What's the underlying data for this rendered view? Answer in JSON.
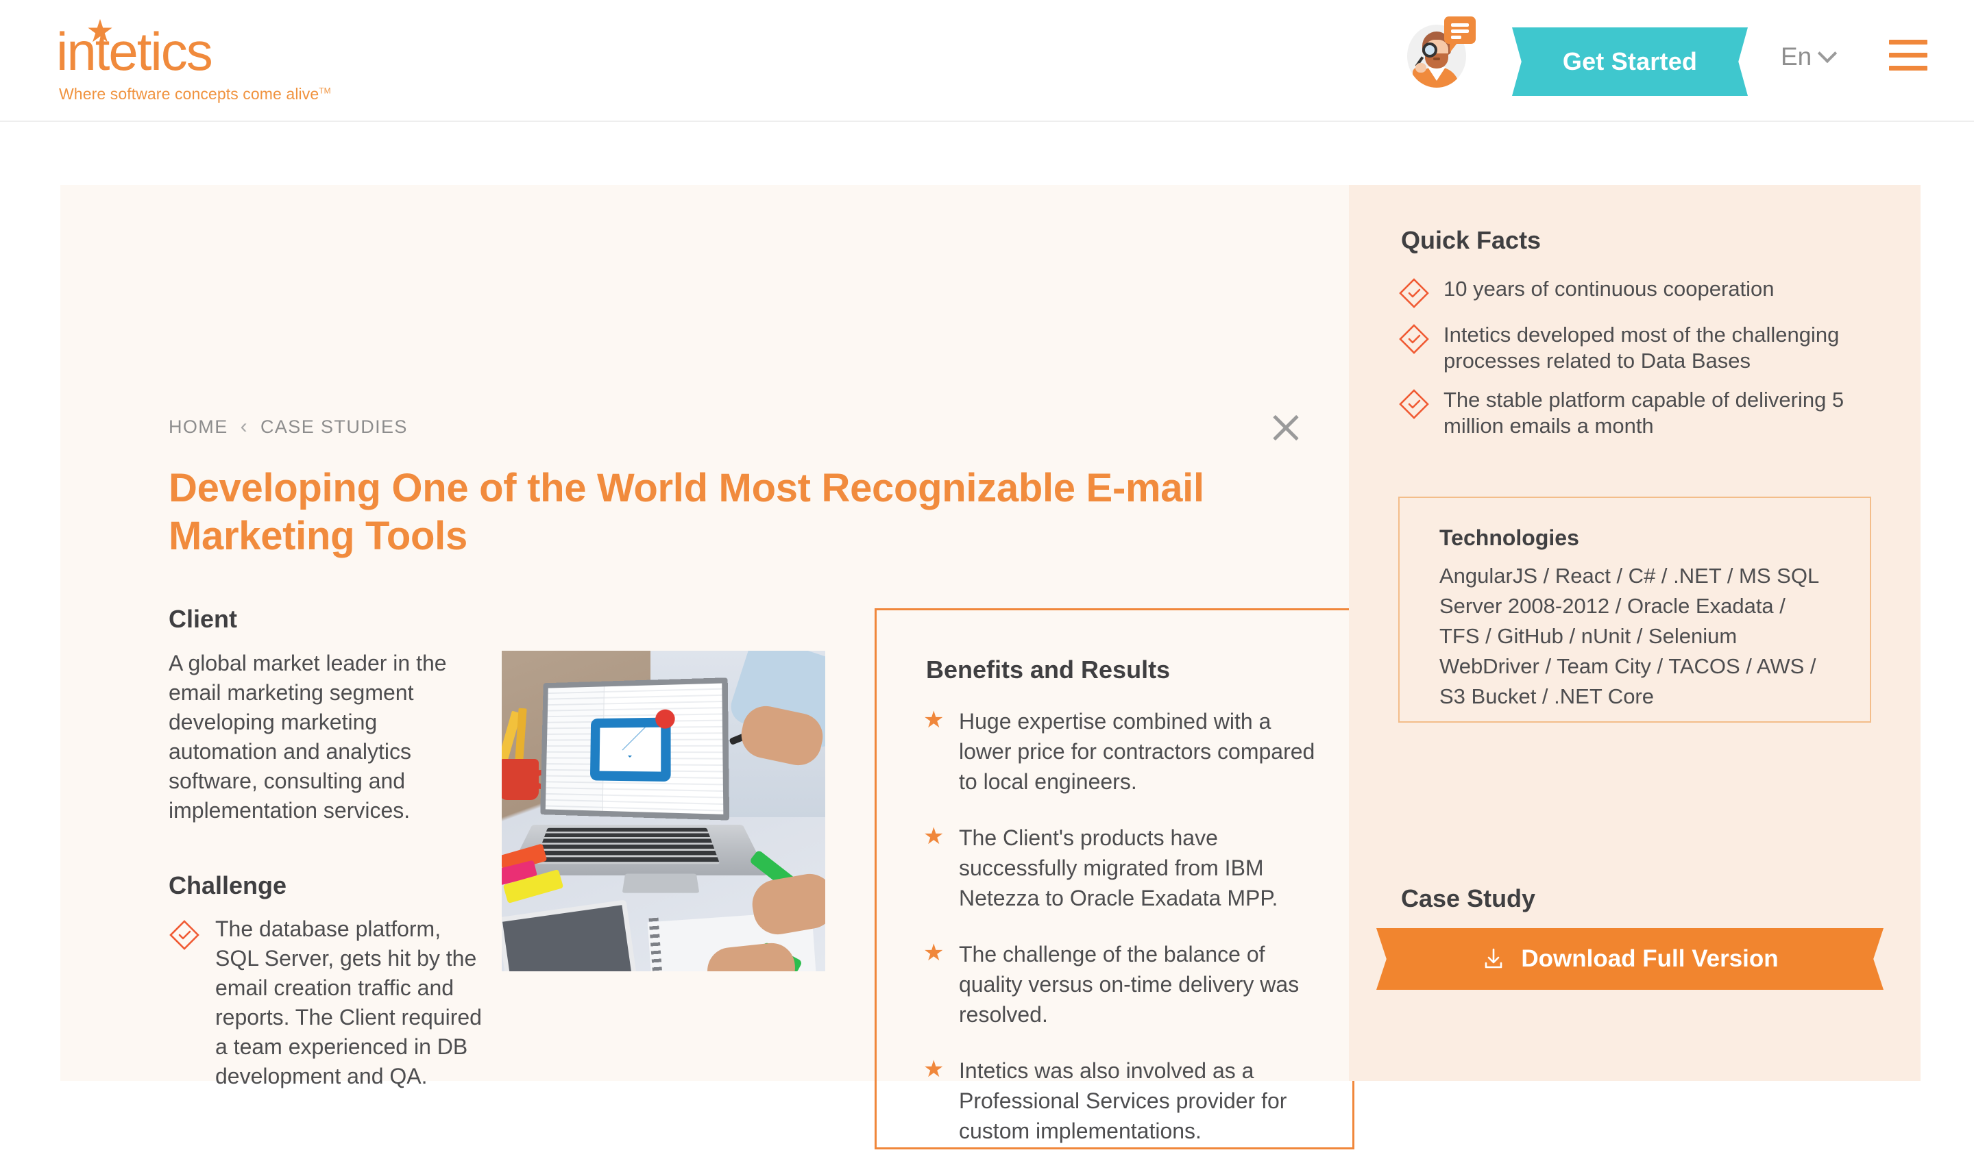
{
  "header": {
    "logo": {
      "word": "intetics",
      "tagline": "Where software concepts come alive",
      "tm": "TM",
      "star": "star-icon"
    },
    "avatar": {
      "name": "support-agent-avatar",
      "badge": "chat-bubble-icon"
    },
    "cta_label": "Get Started",
    "language": "En",
    "menu": "hamburger-menu"
  },
  "breadcrumb": {
    "home": "HOME",
    "separator": "‹",
    "current": "CASE STUDIES"
  },
  "close_label": "×",
  "case": {
    "title": "Developing One of the World Most Recognizable E-mail Marketing Tools",
    "client": {
      "heading": "Client",
      "body": "A global market leader in the email marketing segment developing marketing automation and analytics software, consulting and implementation services."
    },
    "challenge": {
      "heading": "Challenge",
      "items": [
        "The database platform, SQL Server, gets hit by the email creation traffic and reports. The Client required a team experienced in DB development and QA."
      ]
    },
    "photo_alt": "laptop-email-marketing-photo"
  },
  "benefits": {
    "heading": "Benefits and Results",
    "items": [
      "Huge expertise combined with a lower price for contractors compared to local engineers.",
      "The Client's products have successfully migrated from IBM Netezza to Oracle Exadata MPP.",
      "The challenge of the balance of quality versus on-time delivery was resolved.",
      "Intetics was also involved as a Professional Services provider for custom implementations."
    ]
  },
  "quick_facts": {
    "heading": "Quick Facts",
    "items": [
      "10 years of continuous cooperation",
      "Intetics developed most of the challenging processes related to Data Bases",
      "The stable platform capable of delivering 5 million emails a month"
    ]
  },
  "technologies": {
    "heading": "Technologies",
    "body": "AngularJS / React / C# / .NET / MS SQL Server 2008-2012 / Oracle Exadata / TFS / GitHub / nUnit / Selenium WebDriver / Team City / TACOS / AWS / S3 Bucket / .NET Core"
  },
  "case_study": {
    "heading": "Case Study",
    "download_label": "Download Full Version"
  },
  "colors": {
    "brand_orange": "#F0873B",
    "title_orange": "#F18B3D",
    "teal": "#3FC7CE",
    "diamond_red": "#F05A33",
    "panel_bg": "#FDF8F3",
    "sidebar_bg": "#FBEDE2",
    "text_dark": "#4D4D4F",
    "muted_gray": "#8D8D8D"
  }
}
